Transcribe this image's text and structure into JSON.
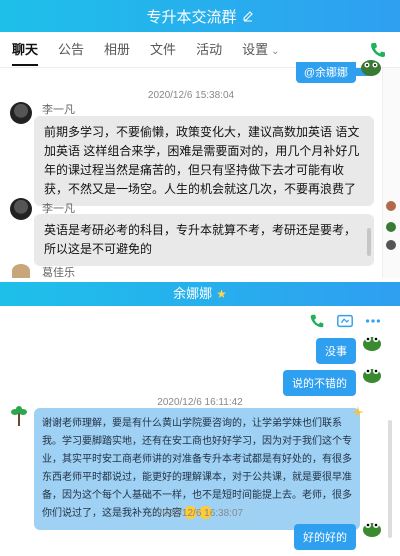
{
  "top": {
    "title": "专升本交流群",
    "tabs": [
      "聊天",
      "公告",
      "相册",
      "文件",
      "活动",
      "设置"
    ],
    "tag_text": "@余娜娜"
  },
  "messages_top": [
    {
      "time": "2020/12/6 15:38:04",
      "sender": "李一凡",
      "text": "前期多学习，不要偷懒，政策变化大，建议高数加英语 语文加英语 这样组合来学，困难是需要面对的，用几个月补好几年的课过程当然是痛苦的，但只有坚持做下去才可能有收获，不然又是一场空。人生的机会就这几次，不要再浪费了"
    },
    {
      "sender": "李一凡",
      "text": "英语是考研必考的科目，专升本就算不考，考研还是要考，所以这是不可避免的"
    },
    {
      "sender": "葛佳乐"
    }
  ],
  "bottom": {
    "title": "余娜娜",
    "messages": [
      {
        "text": "没事"
      },
      {
        "text": "说的不错的"
      },
      {
        "time": "2020/12/6 16:11:42"
      },
      {
        "text": "谢谢老师理解，要是有什么黄山学院要咨询的，让学弟学妹也们联系我。学习要脚踏实地，还有在安工商也好好学习，因为对于我们这个专业，其实平时安工商老师讲的对准备专升本考试都是有好处的，有很多东西老师平时都说过，能更好的理解课本，对于公共课，就是要很早准备，因为这个每个人基础不一样，也不是短时间能提上去。老师，很多你们说过了，这是我补充的内容"
      },
      {
        "time": "2020/12/6 16:38:07"
      },
      {
        "text": "好的好的"
      }
    ]
  },
  "colors": {
    "accent": "#2f9ff0",
    "bubble_light": "#9fd1f5",
    "green": "#20b25a"
  }
}
